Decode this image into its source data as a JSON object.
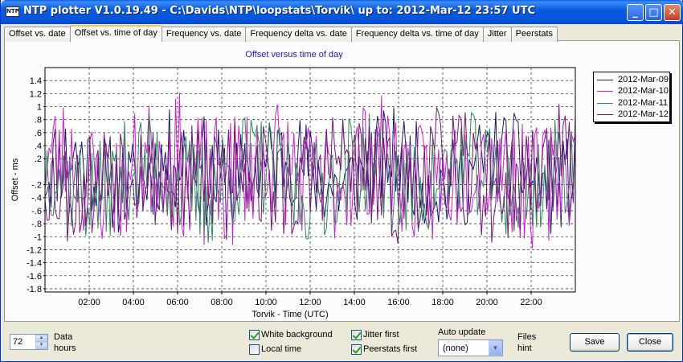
{
  "window": {
    "icon_text": "NTP",
    "title": "NTP plotter V1.0.19.49 - C:\\Davids\\NTP\\loopstats\\Torvik\\  up to: 2012-Mar-12 23:57 UTC",
    "minimize_glyph": "_",
    "maximize_glyph": "□",
    "close_glyph": "✕"
  },
  "tabs": [
    {
      "label": "Offset vs. date",
      "active": false
    },
    {
      "label": "Offset vs. time of day",
      "active": true
    },
    {
      "label": "Frequency vs. date",
      "active": false
    },
    {
      "label": "Frequency delta vs. date",
      "active": false
    },
    {
      "label": "Frequency delta vs. time of day",
      "active": false
    },
    {
      "label": "Jitter",
      "active": false
    },
    {
      "label": "Peerstats",
      "active": false
    }
  ],
  "chart_data": {
    "type": "line",
    "title": "Offset versus time of day",
    "xlabel": "Torvik  -  Time (UTC)",
    "ylabel": "Offset  -  ms",
    "xlim": [
      0,
      24
    ],
    "ylim": [
      -1.85,
      1.6
    ],
    "x_ticks": [
      {
        "value": 2,
        "label": "02:00"
      },
      {
        "value": 4,
        "label": "04:00"
      },
      {
        "value": 6,
        "label": "06:00"
      },
      {
        "value": 8,
        "label": "08:00"
      },
      {
        "value": 10,
        "label": "10:00"
      },
      {
        "value": 12,
        "label": "12:00"
      },
      {
        "value": 14,
        "label": "14:00"
      },
      {
        "value": 16,
        "label": "16:00"
      },
      {
        "value": 18,
        "label": "18:00"
      },
      {
        "value": 20,
        "label": "20:00"
      },
      {
        "value": 22,
        "label": "22:00"
      }
    ],
    "y_ticks": [
      {
        "value": 1.4,
        "label": "1.4"
      },
      {
        "value": 1.2,
        "label": "1.2"
      },
      {
        "value": 1.0,
        "label": "1"
      },
      {
        "value": 0.8,
        "label": ".8"
      },
      {
        "value": 0.6,
        "label": ".6"
      },
      {
        "value": 0.4,
        "label": ".4"
      },
      {
        "value": 0.2,
        "label": ".2"
      },
      {
        "value": -0.2,
        "label": "-.2"
      },
      {
        "value": -0.4,
        "label": "-.4"
      },
      {
        "value": -0.6,
        "label": "-.6"
      },
      {
        "value": -0.8,
        "label": "-.8"
      },
      {
        "value": -1.0,
        "label": "-1"
      },
      {
        "value": -1.2,
        "label": "-1.2"
      },
      {
        "value": -1.4,
        "label": "-1.4"
      },
      {
        "value": -1.6,
        "label": "-1.6"
      },
      {
        "value": -1.8,
        "label": "-1.8"
      }
    ],
    "grid": true,
    "legend_position": "top-right",
    "series": [
      {
        "name": "2012-Mar-09",
        "color": "#1a1a6e",
        "amp": 0.75,
        "center": 0.0,
        "seed": 11
      },
      {
        "name": "2012-Mar-10",
        "color": "#cc22cc",
        "amp": 0.95,
        "center": 0.0,
        "seed": 23
      },
      {
        "name": "2012-Mar-11",
        "color": "#2e8b57",
        "amp": 0.8,
        "center": -0.1,
        "seed": 37
      },
      {
        "name": "2012-Mar-12",
        "color": "#7a1480",
        "amp": 0.85,
        "center": -0.05,
        "seed": 53
      }
    ]
  },
  "controls": {
    "data_hours_value": "72",
    "data_label": "Data",
    "hours_label": "hours",
    "white_background_label": "White background",
    "white_background_checked": true,
    "local_time_label": "Local time",
    "local_time_checked": false,
    "jitter_first_label": "Jitter first",
    "jitter_first_checked": true,
    "peerstats_first_label": "Peerstats first",
    "peerstats_first_checked": true,
    "auto_update_label": "Auto update",
    "auto_update_value": "(none)",
    "files_label": "Files",
    "hint_label": "hint",
    "save_label": "Save",
    "close_label": "Close"
  }
}
